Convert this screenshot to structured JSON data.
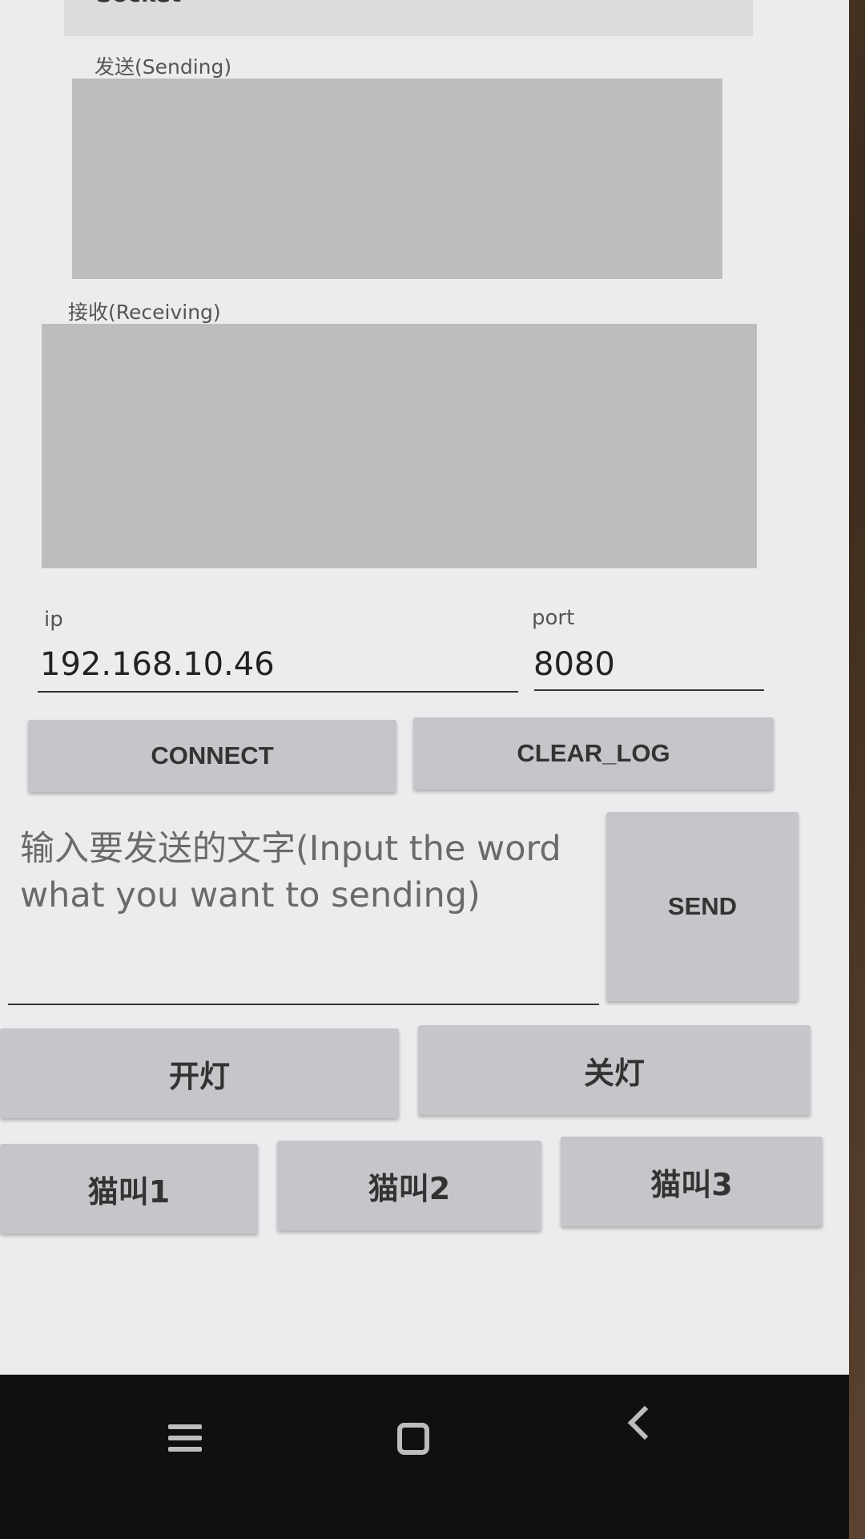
{
  "app": {
    "title": "Socket"
  },
  "sending": {
    "label": "发送(Sending)",
    "content": ""
  },
  "receiving": {
    "label": "接收(Receiving)",
    "content": ""
  },
  "connection": {
    "ip_label": "ip",
    "ip_value": "192.168.10.46",
    "port_label": "port",
    "port_value": "8080"
  },
  "buttons": {
    "connect": "CONNECT",
    "clear_log": "CLEAR_LOG",
    "send": "SEND",
    "light_on": "开灯",
    "light_off": "关灯",
    "meow1": "猫叫1",
    "meow2": "猫叫2",
    "meow3": "猫叫3"
  },
  "message_input": {
    "placeholder": "输入要发送的文字(Input the word what you want to sending)",
    "value": ""
  },
  "navbar": {
    "icons": [
      "menu-icon",
      "home-icon",
      "back-icon"
    ]
  }
}
